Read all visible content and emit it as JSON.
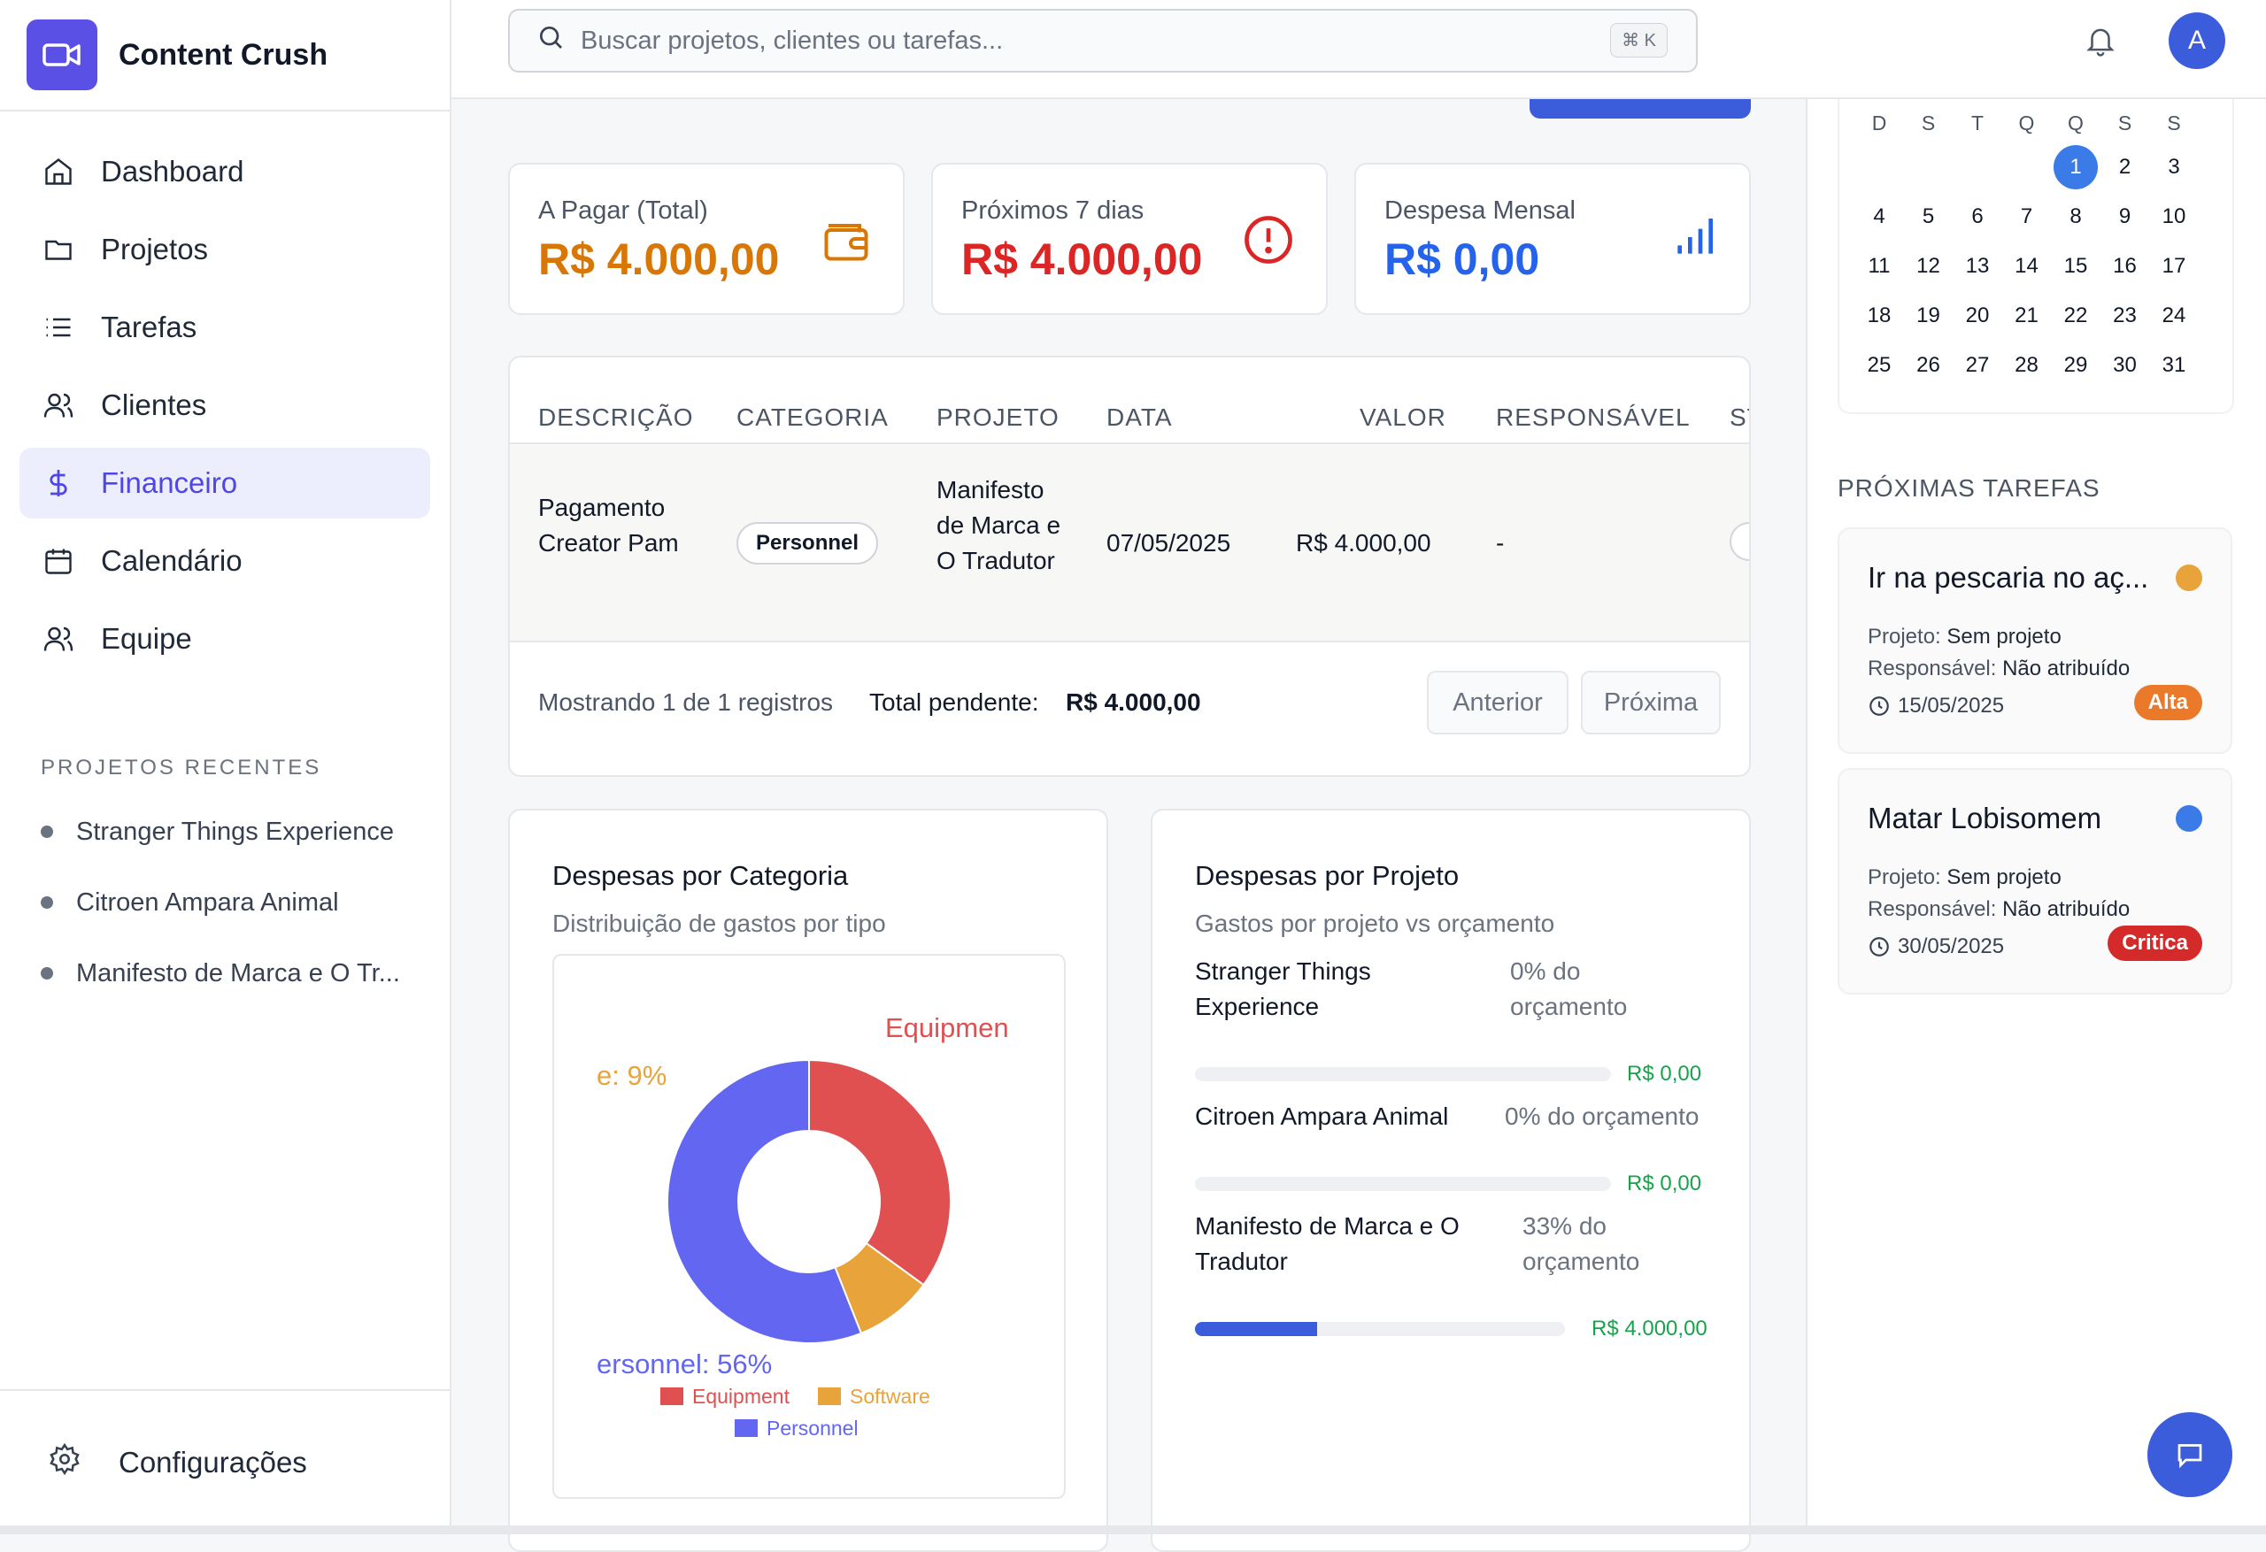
{
  "app": {
    "name": "Content Crush"
  },
  "nav": [
    {
      "label": "Dashboard",
      "icon": "home-icon"
    },
    {
      "label": "Projetos",
      "icon": "folder-icon"
    },
    {
      "label": "Tarefas",
      "icon": "list-icon"
    },
    {
      "label": "Clientes",
      "icon": "users-icon"
    },
    {
      "label": "Financeiro",
      "icon": "dollar-icon",
      "active": true
    },
    {
      "label": "Calendário",
      "icon": "calendar-icon"
    },
    {
      "label": "Equipe",
      "icon": "team-icon"
    }
  ],
  "recent": {
    "title": "PROJETOS RECENTES",
    "items": [
      "Stranger Things Experience",
      "Citroen Ampara Animal",
      "Manifesto de Marca e O Tr..."
    ]
  },
  "settings": {
    "label": "Configurações"
  },
  "search": {
    "placeholder": "Buscar projetos, clientes ou tarefas...",
    "shortcut": "⌘ K"
  },
  "user": {
    "initial": "A"
  },
  "stats": [
    {
      "label": "A Pagar (Total)",
      "value": "R$ 4.000,00",
      "color": "#d97706",
      "icon": "wallet-icon"
    },
    {
      "label": "Próximos 7 dias",
      "value": "R$ 4.000,00",
      "color": "#dc2626",
      "icon": "alert-icon"
    },
    {
      "label": "Despesa Mensal",
      "value": "R$ 0,00",
      "color": "#2563eb",
      "icon": "chart-bar-icon"
    }
  ],
  "table": {
    "headers": [
      "DESCRIÇÃO",
      "CATEGORIA",
      "PROJETO",
      "DATA",
      "VALOR",
      "RESPONSÁVEL",
      "ST"
    ],
    "rows": [
      {
        "descricao": "Pagamento Creator Pam",
        "categoria": "Personnel",
        "projeto": "Manifesto de Marca e O Tradutor",
        "data": "07/05/2025",
        "valor": "R$ 4.000,00",
        "responsavel": "-"
      }
    ],
    "footer": {
      "showing": "Mostrando 1 de 1 registros",
      "total_label": "Total pendente:",
      "total_value": "R$ 4.000,00",
      "prev": "Anterior",
      "next": "Próxima"
    }
  },
  "category_card": {
    "title": "Despesas por Categoria",
    "subtitle": "Distribuição de gastos por tipo"
  },
  "chart_data": {
    "type": "pie",
    "title": "",
    "categories": [
      "Equipment",
      "Software",
      "Personnel"
    ],
    "values": [
      35,
      9,
      56
    ],
    "colors": [
      "#e05050",
      "#e8a33a",
      "#6366f1"
    ],
    "slice_labels": [
      "Equipmen",
      "e: 9%",
      "ersonnel: 56%"
    ]
  },
  "project_card": {
    "title": "Despesas por Projeto",
    "subtitle": "Gastos por projeto vs orçamento",
    "items": [
      {
        "name": "Stranger Things Experience",
        "pct_label": "0% do orçamento",
        "fill": 0,
        "amount": "R$ 0,00"
      },
      {
        "name": "Citroen Ampara Animal",
        "pct_label": "0% do orçamento",
        "fill": 0,
        "amount": "R$ 0,00"
      },
      {
        "name": "Manifesto de Marca e O Tradutor",
        "pct_label": "33% do orçamento",
        "fill": 0.33,
        "amount": "R$ 4.000,00"
      }
    ]
  },
  "calendar": {
    "dow": [
      "D",
      "S",
      "T",
      "Q",
      "Q",
      "S",
      "S"
    ],
    "weeks": [
      [
        "",
        "",
        "",
        "",
        "1",
        "2",
        "3"
      ],
      [
        "4",
        "5",
        "6",
        "7",
        "8",
        "9",
        "10"
      ],
      [
        "11",
        "12",
        "13",
        "14",
        "15",
        "16",
        "17"
      ],
      [
        "18",
        "19",
        "20",
        "21",
        "22",
        "23",
        "24"
      ],
      [
        "25",
        "26",
        "27",
        "28",
        "29",
        "30",
        "31"
      ]
    ],
    "selected": "1"
  },
  "tasks": {
    "title": "PRÓXIMAS TAREFAS",
    "items": [
      {
        "title": "Ir na pescaria no aç...",
        "project_label": "Projeto:",
        "project": "Sem projeto",
        "resp_label": "Responsável:",
        "resp": "Não atribuído",
        "date": "15/05/2025",
        "badge": "Alta",
        "badge_color": "#ea7a2a",
        "dot_color": "#e8a33a"
      },
      {
        "title": "Matar Lobisomem",
        "project_label": "Projeto:",
        "project": "Sem projeto",
        "resp_label": "Responsável:",
        "resp": "Não atribuído",
        "date": "30/05/2025",
        "badge": "Critica",
        "badge_color": "#d42a2a",
        "dot_color": "#3b7be8"
      }
    ]
  }
}
